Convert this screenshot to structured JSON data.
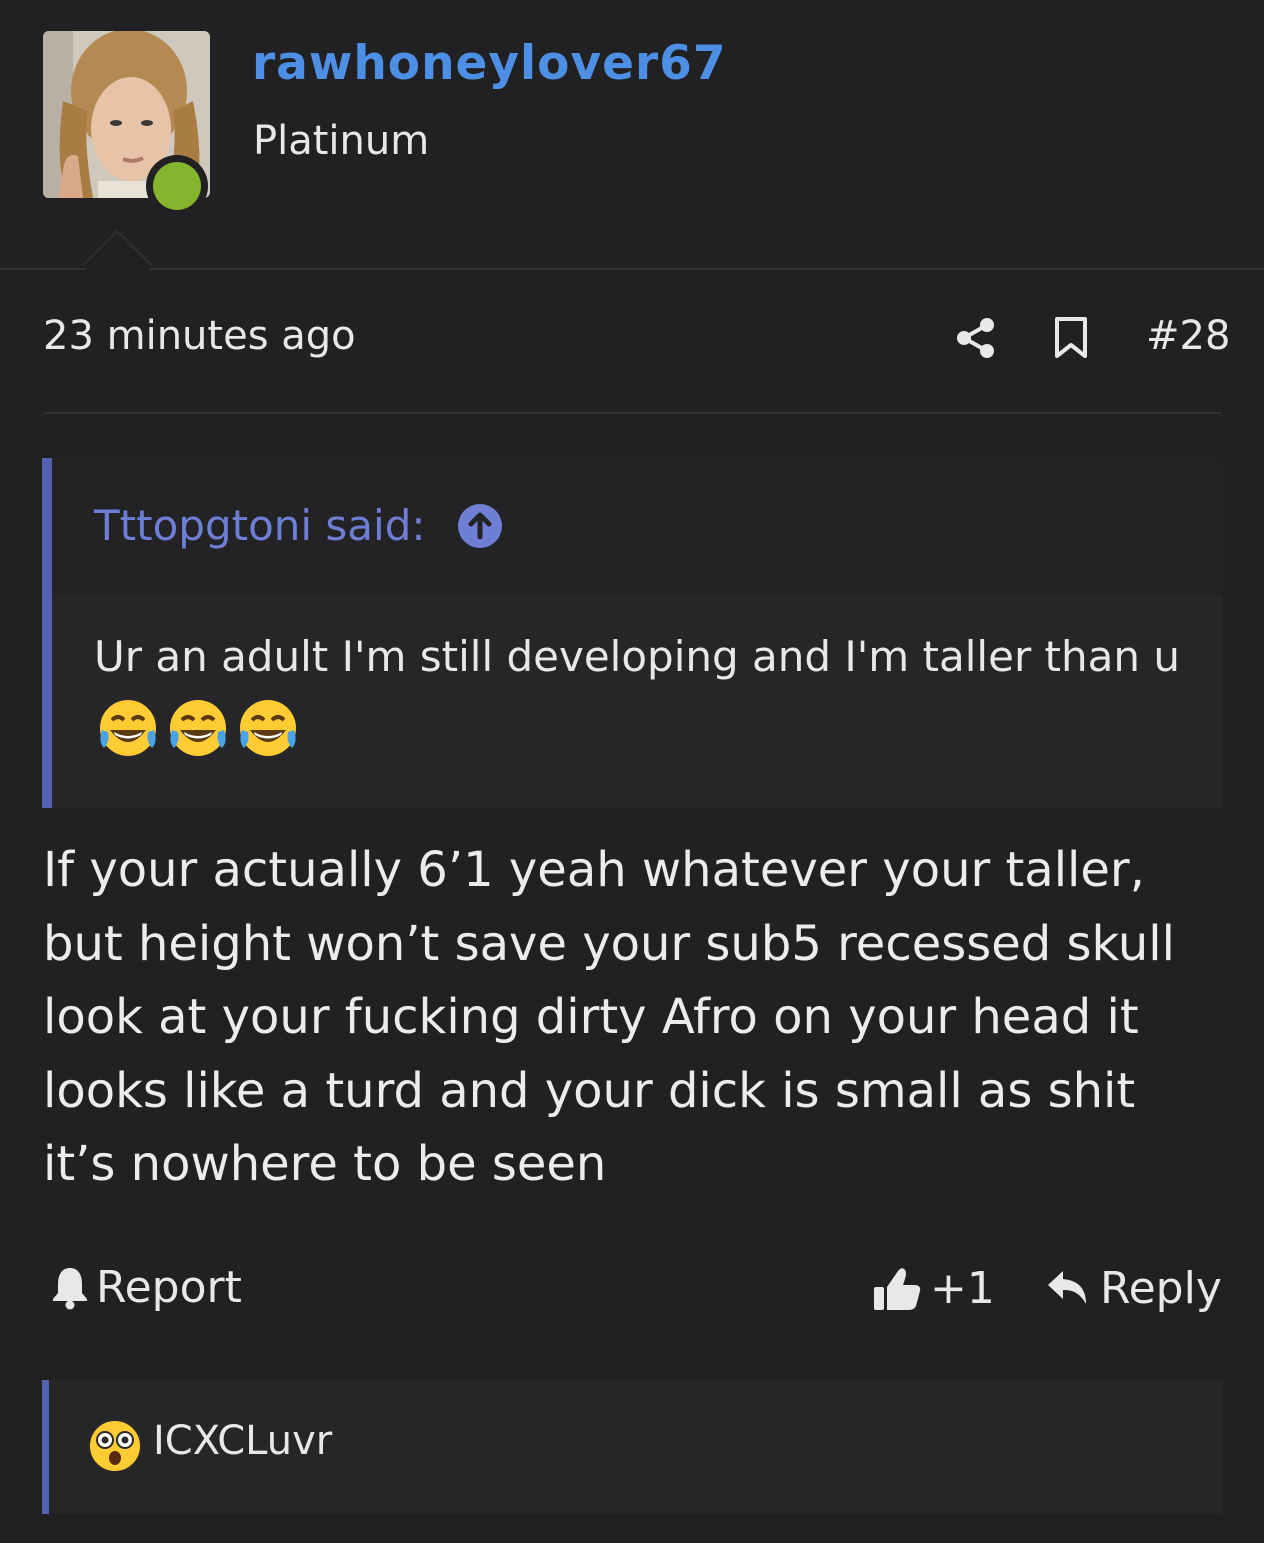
{
  "user": {
    "name": "rawhoneylover67",
    "rank": "Platinum",
    "status": "online"
  },
  "meta": {
    "time": "23 minutes ago",
    "post_number": "#28"
  },
  "quote": {
    "author": "Tttopgtoni said:",
    "text": "Ur an adult I'm still developing and I'm taller than u",
    "emojis": [
      "😂",
      "😂",
      "😂"
    ]
  },
  "body": {
    "lines": [
      "If your actually 6’1 yeah whatever your taller,",
      "but height won’t save your sub5 recessed skull",
      "look at your fucking dirty Afro on your head it",
      "looks like a turd and your dick is small as shit",
      "it’s nowhere to be seen"
    ]
  },
  "actions": {
    "report": "Report",
    "like_count": "+1",
    "reply": "Reply"
  },
  "reactions": {
    "emoji": "😳",
    "user": "ICXCLuvr"
  },
  "colors": {
    "background": "#212123",
    "username": "#4e8fe6",
    "quote_accent": "#5461b2",
    "quote_author": "#6e7ed4",
    "online": "#85b52f"
  }
}
